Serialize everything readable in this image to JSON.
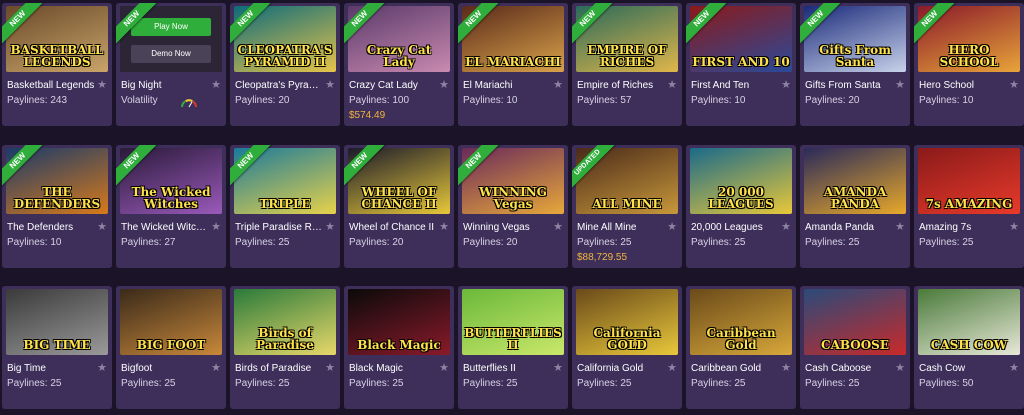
{
  "labels": {
    "paylines_prefix": "Paylines: ",
    "volatility": "Volatility",
    "new_badge": "NEW",
    "updated_badge": "UPDATED",
    "play_now": "Play Now",
    "demo_now": "Demo Now"
  },
  "colors": {
    "page_bg": "#1b1429",
    "card_bg": "#3d2f5a",
    "ribbon_green": "#2fae3b",
    "jackpot_gold": "#f1b43d",
    "star_gray": "#8d84a3"
  },
  "rows": [
    [
      {
        "name": "Basketball Legends",
        "paylines": "243",
        "badge": "NEW",
        "thumb_text": "BASKETBALL LEGENDS",
        "thumb_colors": [
          "#6a4a2a",
          "#c9a46a"
        ]
      },
      {
        "name": "Big Night",
        "volatility": true,
        "badge": "NEW",
        "demo": true
      },
      {
        "name": "Cleopatra's Pyramid II",
        "name_display": "Cleopatra's Pyram...",
        "paylines": "20",
        "badge": "NEW",
        "thumb_text": "CLEOPATRA'S PYRAMID II",
        "thumb_colors": [
          "#0d6b7a",
          "#e6c44a"
        ]
      },
      {
        "name": "Crazy Cat Lady",
        "paylines": "100",
        "jackpot": "$574.49",
        "badge": "NEW",
        "thumb_text": "Crazy Cat Lady",
        "thumb_colors": [
          "#5a3a6a",
          "#c98ab0"
        ]
      },
      {
        "name": "El Mariachi",
        "paylines": "10",
        "badge": "NEW",
        "thumb_text": "EL MARIACHI",
        "thumb_colors": [
          "#5a2a1a",
          "#d8a24a"
        ]
      },
      {
        "name": "Empire of Riches",
        "paylines": "57",
        "badge": "NEW",
        "thumb_text": "EMPIRE OF RICHES",
        "thumb_colors": [
          "#2a6a5a",
          "#e0b64a"
        ]
      },
      {
        "name": "First And Ten",
        "paylines": "10",
        "badge": "NEW",
        "thumb_text": "FIRST AND 10",
        "thumb_colors": [
          "#8a1a1a",
          "#2a4a9a"
        ]
      },
      {
        "name": "Gifts From Santa",
        "paylines": "20",
        "badge": "NEW",
        "thumb_text": "Gifts From Santa",
        "thumb_colors": [
          "#1a2a7a",
          "#c8d2ea"
        ]
      },
      {
        "name": "Hero School",
        "paylines": "10",
        "badge": "NEW",
        "thumb_text": "HERO SCHOOL",
        "thumb_colors": [
          "#8a1a2a",
          "#e8a43a"
        ]
      }
    ],
    [
      {
        "name": "The Defenders",
        "paylines": "10",
        "badge": "NEW",
        "thumb_text": "THE DEFENDERS",
        "thumb_colors": [
          "#1a3a6a",
          "#d87a1a"
        ]
      },
      {
        "name": "The Wicked Witches",
        "paylines": "27",
        "badge": "NEW",
        "thumb_text": "The Wicked Witches",
        "thumb_colors": [
          "#2a1a3a",
          "#9a5aba"
        ]
      },
      {
        "name": "Triple Paradise Riches",
        "name_display": "Triple Paradise Ric...",
        "paylines": "25",
        "badge": "NEW",
        "thumb_text": "TRIPLE",
        "thumb_colors": [
          "#1a7a9a",
          "#e8d24a"
        ]
      },
      {
        "name": "Wheel of Chance II",
        "paylines": "20",
        "badge": "NEW",
        "thumb_text": "WHEEL OF CHANCE II",
        "thumb_colors": [
          "#1a1a2a",
          "#e8c83a"
        ]
      },
      {
        "name": "Winning Vegas",
        "paylines": "20",
        "badge": "NEW",
        "thumb_text": "WINNING Vegas",
        "thumb_colors": [
          "#6a2a5a",
          "#e8a83a"
        ]
      },
      {
        "name": "Mine All Mine",
        "paylines": "25",
        "jackpot": "$88,729.55",
        "badge": "UPDATED",
        "thumb_text": "ALL MINE",
        "thumb_colors": [
          "#4a2a1a",
          "#c8983a"
        ]
      },
      {
        "name": "20,000 Leagues",
        "paylines": "25",
        "thumb_text": "20 000 LEAGUES",
        "thumb_colors": [
          "#1a6a8a",
          "#e8c83a"
        ]
      },
      {
        "name": "Amanda Panda",
        "paylines": "25",
        "thumb_text": "AMANDA PANDA",
        "thumb_colors": [
          "#2a2a5a",
          "#e8a82a"
        ]
      },
      {
        "name": "Amazing 7s",
        "paylines": "25",
        "thumb_text": "7s AMAZING",
        "thumb_colors": [
          "#8a1a1a",
          "#e83a2a"
        ]
      }
    ],
    [
      {
        "name": "Big Time",
        "paylines": "25",
        "thumb_text": "BIG TIME",
        "thumb_colors": [
          "#3a3a3a",
          "#9a9a9a"
        ]
      },
      {
        "name": "Bigfoot",
        "paylines": "25",
        "thumb_text": "BIG FOOT",
        "thumb_colors": [
          "#3a2a1a",
          "#c8883a"
        ]
      },
      {
        "name": "Birds of Paradise",
        "paylines": "25",
        "thumb_text": "Birds of Paradise",
        "thumb_colors": [
          "#2a7a3a",
          "#e8d86a"
        ]
      },
      {
        "name": "Black Magic",
        "paylines": "25",
        "thumb_text": "Black Magic",
        "thumb_colors": [
          "#0a0a0a",
          "#8a1a2a"
        ]
      },
      {
        "name": "Butterflies II",
        "paylines": "25",
        "thumb_text": "BUTTERFLIES II",
        "thumb_colors": [
          "#6ab83a",
          "#cae86a"
        ]
      },
      {
        "name": "California Gold",
        "paylines": "25",
        "thumb_text": "California GOLD",
        "thumb_colors": [
          "#6a4a1a",
          "#e8c83a"
        ]
      },
      {
        "name": "Caribbean Gold",
        "paylines": "25",
        "thumb_text": "Caribbean Gold",
        "thumb_colors": [
          "#6a4a1a",
          "#d8a83a"
        ]
      },
      {
        "name": "Cash Caboose",
        "paylines": "25",
        "thumb_text": "CABOOSE",
        "thumb_colors": [
          "#2a4a7a",
          "#c82a2a"
        ]
      },
      {
        "name": "Cash Cow",
        "paylines": "50",
        "thumb_text": "CASH COW",
        "thumb_colors": [
          "#4a7a3a",
          "#e8e8d8"
        ]
      }
    ]
  ]
}
